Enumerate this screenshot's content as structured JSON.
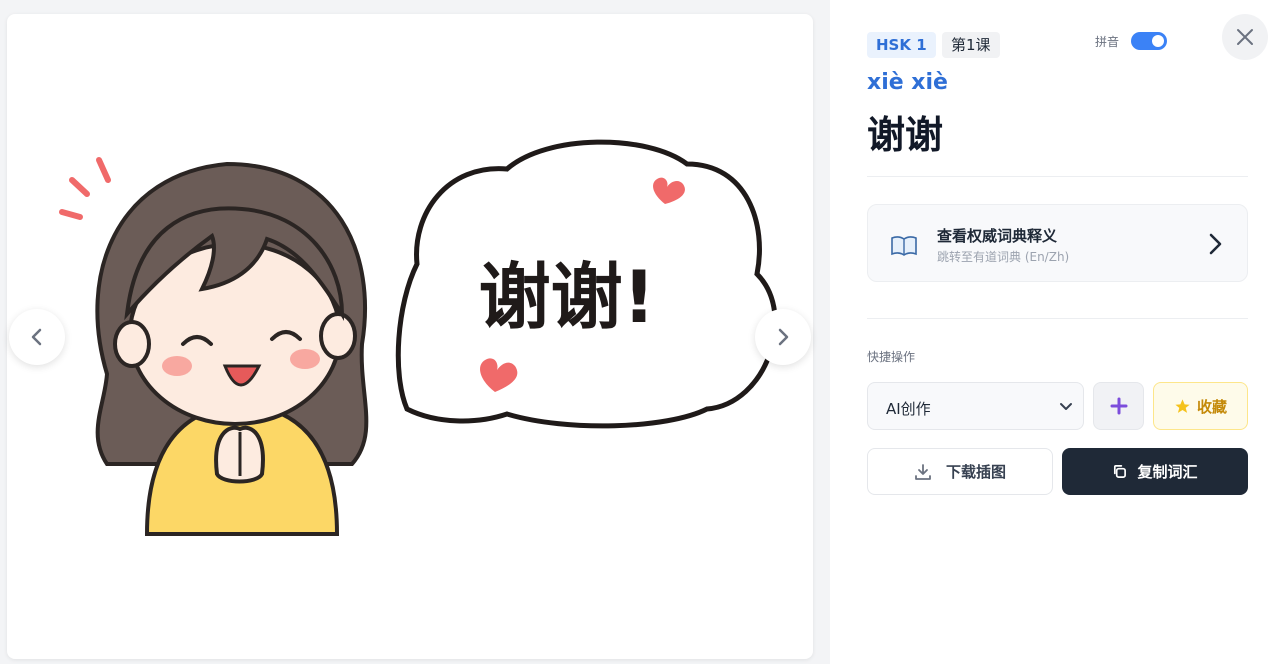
{
  "badges": {
    "level": "HSK 1",
    "lesson": "第1课"
  },
  "pinyin_toggle": {
    "label": "拼音",
    "on": true
  },
  "word": {
    "pinyin": "xiè xiè",
    "hanzi": "谢谢"
  },
  "illustration": {
    "speech_text": "谢谢!"
  },
  "dictionary": {
    "title": "查看权威词典释义",
    "subtitle": "跳转至有道词典 (En/Zh)"
  },
  "quick_actions": {
    "label": "快捷操作",
    "select_value": "AI创作",
    "favorite_label": "收藏",
    "download_label": "下载插图",
    "copy_label": "复制词汇"
  },
  "colors": {
    "accent": "#2f6fd6",
    "toggle": "#3b82f6",
    "dark_button": "#1f2937",
    "favorite": "#c48a0a"
  },
  "icons": [
    "chevron-left-icon",
    "chevron-right-icon",
    "close-icon",
    "book-icon",
    "chevron-right-icon",
    "chevron-down-icon",
    "plus-icon",
    "star-icon",
    "download-icon",
    "copy-icon"
  ]
}
